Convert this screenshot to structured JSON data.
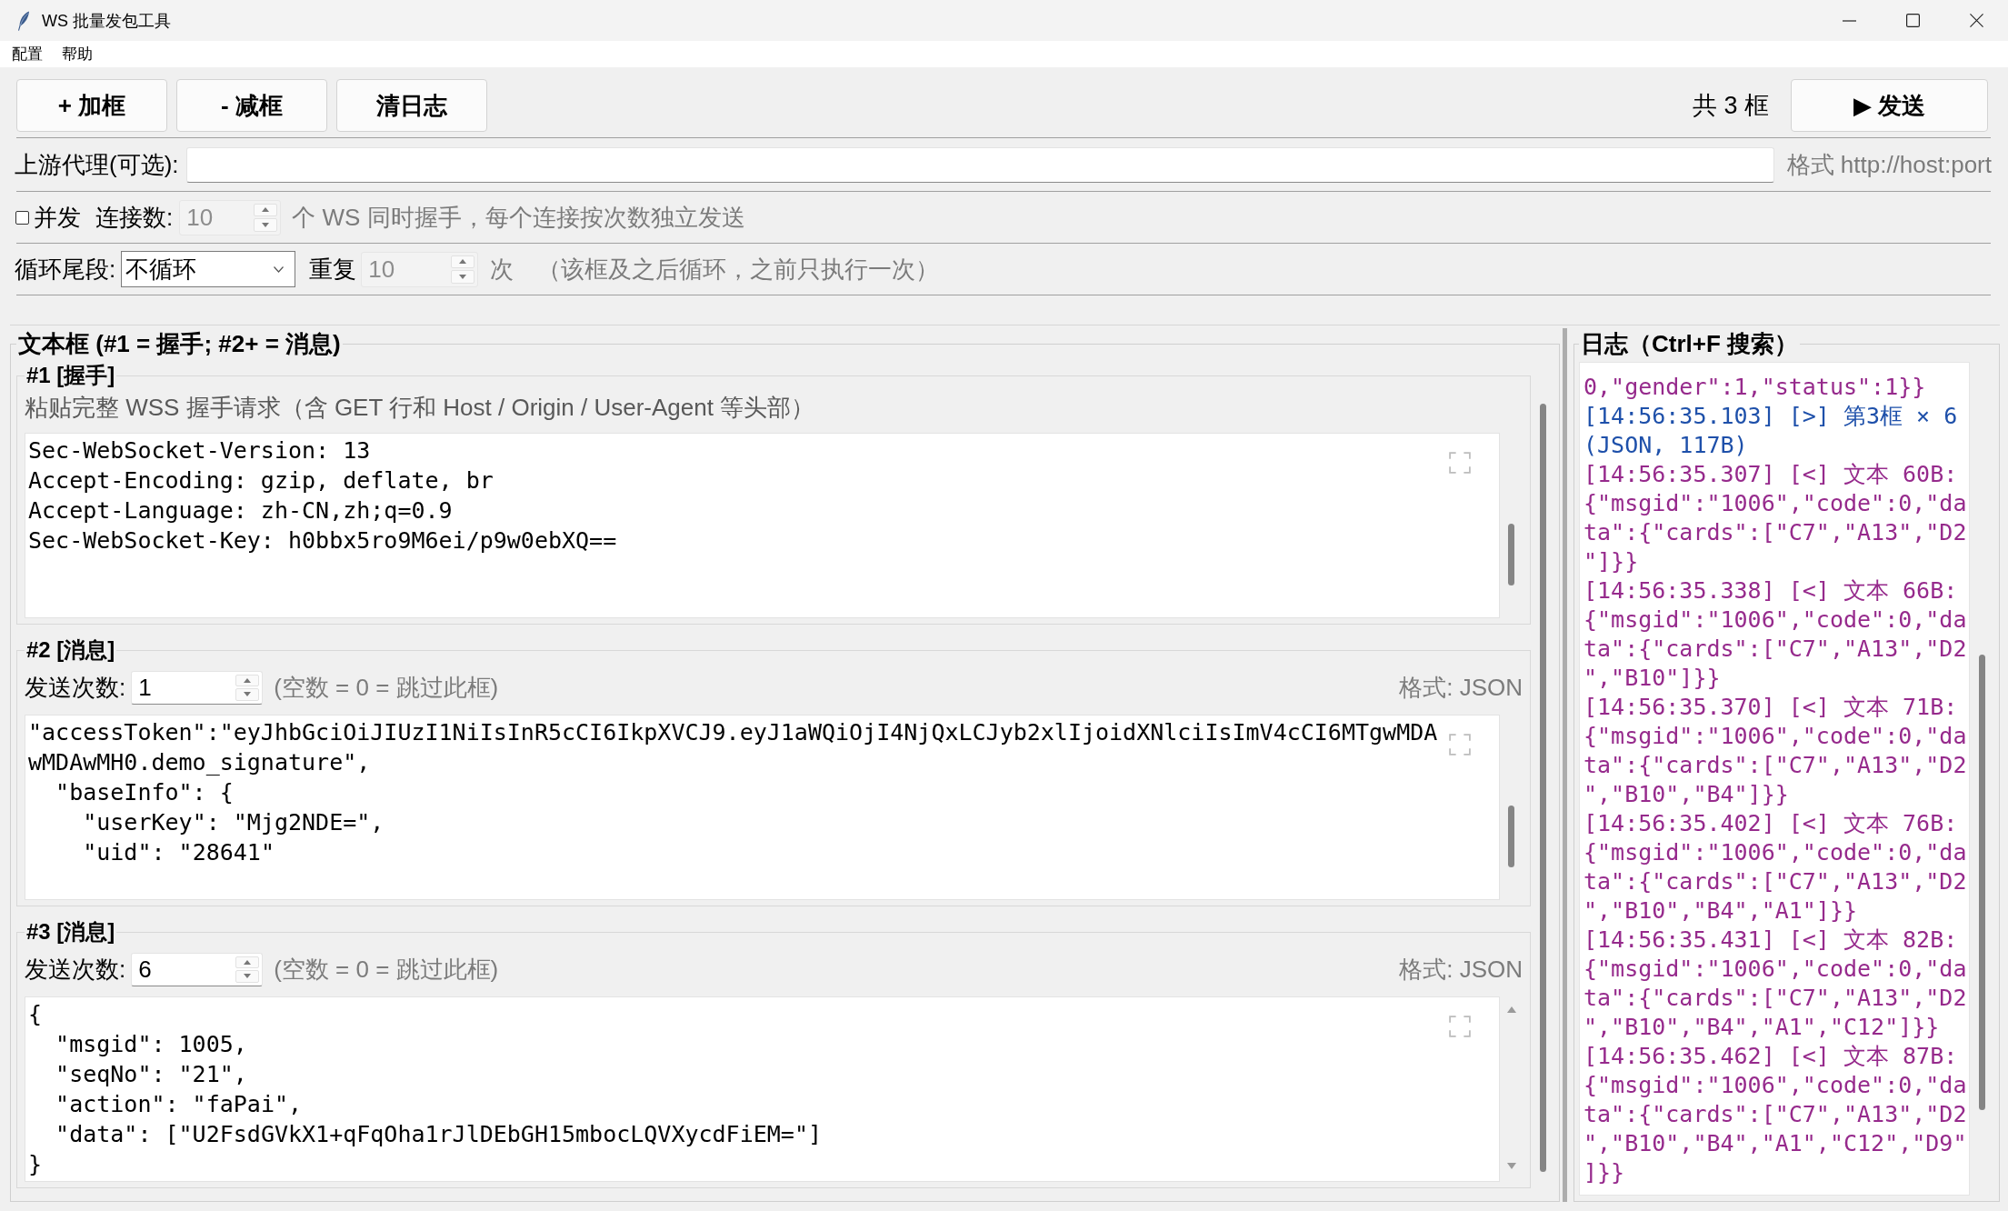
{
  "window": {
    "title": "WS 批量发包工具"
  },
  "menu": [
    "配置",
    "帮助"
  ],
  "toolbar": {
    "buttons": [
      "+ 加框",
      "- 减框",
      "清日志"
    ],
    "frame_count": "共 3 框",
    "send_button": "▶ 发送"
  },
  "proxy": {
    "label": "上游代理(可选):",
    "hint": "格式 http://host:port"
  },
  "concurrency": {
    "checked": false,
    "label": "并发",
    "count_label": "连接数:",
    "count": "10",
    "count_disabled": true,
    "note": "个 WS 同时握手，每个连接按次数独立发送"
  },
  "loop": {
    "label": "循环尾段:",
    "value": "不循环",
    "repeat_label": "重复",
    "repeat": "10",
    "repeat_disabled": true,
    "unit": "次",
    "note": "（该框及之后循环，之前只执行一次）"
  },
  "editor": {
    "title": "文本框 (#1 = 握手; #2+ = 消息)",
    "frames": [
      {
        "kind": "handshake",
        "title": "#1 [握手]",
        "hint": "粘贴完整 WSS 握手请求（含 GET 行和 Host / Origin / User-Agent 等头部）",
        "content": "Sec-WebSocket-Version: 13\nAccept-Encoding: gzip, deflate, br\nAccept-Language: zh-CN,zh;q=0.9\nSec-WebSocket-Key: h0bbx5ro9M6ei/p9w0ebXQ=="
      },
      {
        "kind": "message",
        "title": "#2 [消息]",
        "count_label": "发送次数:",
        "count": "1",
        "note": "(空数 = 0 = 跳过此框)",
        "format": "格式: JSON",
        "content": "\"accessToken\":\"eyJhbGciOiJIUzI1NiIsInR5cCI6IkpXVCJ9.eyJ1aWQiOjI4NjQxLCJyb2xlIjoidXNlciIsImV4cCI6MTgwMDAwMDAwMH0.demo_signature\",\n  \"baseInfo\": {\n    \"userKey\": \"Mjg2NDE=\",\n    \"uid\": \"28641\""
      },
      {
        "kind": "message",
        "title": "#3 [消息]",
        "count_label": "发送次数:",
        "count": "6",
        "note": "(空数 = 0 = 跳过此框)",
        "format": "格式: JSON",
        "content": "{\n  \"msgid\": 1005,\n  \"seqNo\": \"21\",\n  \"action\": \"faPai\",\n  \"data\": [\"U2FsdGVkX1+qFqOha1rJlDEbGH15mbocLQVXycdFiEM=\"]\n}"
      }
    ]
  },
  "log": {
    "title": "日志（Ctrl+F 搜索）",
    "entries": [
      {
        "kind": "recv",
        "body": "0,\"gender\":1,\"status\":1}}"
      },
      {
        "kind": "send",
        "text": "[14:56:35.103] [>] 第3框 × 6 (JSON, 117B)"
      },
      {
        "kind": "recv",
        "text": "[14:56:35.307] [<] 文本 60B:",
        "body": "{\"msgid\":\"1006\",\"code\":0,\"data\":{\"cards\":[\"C7\",\"A13\",\"D2\"]}}"
      },
      {
        "kind": "recv",
        "text": "[14:56:35.338] [<] 文本 66B:",
        "body": "{\"msgid\":\"1006\",\"code\":0,\"data\":{\"cards\":[\"C7\",\"A13\",\"D2\",\"B10\"]}}"
      },
      {
        "kind": "recv",
        "text": "[14:56:35.370] [<] 文本 71B:",
        "body": "{\"msgid\":\"1006\",\"code\":0,\"data\":{\"cards\":[\"C7\",\"A13\",\"D2\",\"B10\",\"B4\"]}}"
      },
      {
        "kind": "recv",
        "text": "[14:56:35.402] [<] 文本 76B:",
        "body": "{\"msgid\":\"1006\",\"code\":0,\"data\":{\"cards\":[\"C7\",\"A13\",\"D2\",\"B10\",\"B4\",\"A1\"]}}"
      },
      {
        "kind": "recv",
        "text": "[14:56:35.431] [<] 文本 82B:",
        "body": "{\"msgid\":\"1006\",\"code\":0,\"data\":{\"cards\":[\"C7\",\"A13\",\"D2\",\"B10\",\"B4\",\"A1\",\"C12\"]}}"
      },
      {
        "kind": "recv",
        "text": "[14:56:35.462] [<] 文本 87B:",
        "body": "{\"msgid\":\"1006\",\"code\":0,\"data\":{\"cards\":[\"C7\",\"A13\",\"D2\",\"B10\",\"B4\",\"A1\",\"C12\",\"D9\"]}}"
      }
    ]
  }
}
